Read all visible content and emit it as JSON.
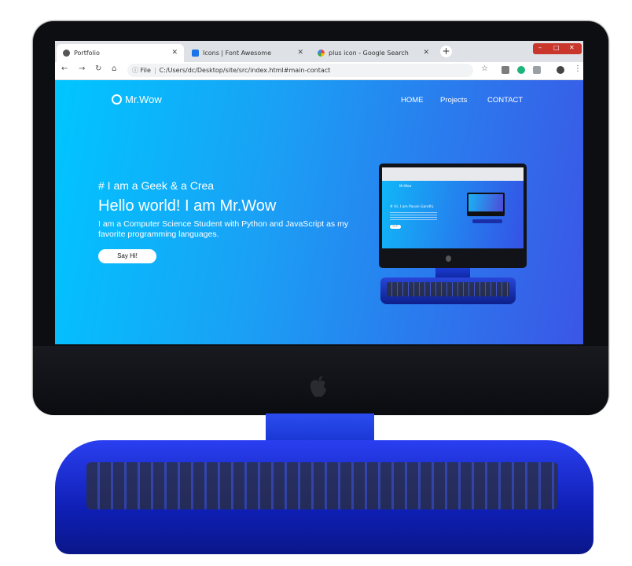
{
  "browser": {
    "tabs": [
      {
        "label": "Portfolio",
        "active": true,
        "icon": "globe-icon",
        "close": "✕"
      },
      {
        "label": "Icons | Font Awesome",
        "active": false,
        "icon": "font-awesome-icon",
        "close": "✕"
      },
      {
        "label": "plus icon - Google Search",
        "active": false,
        "icon": "google-icon",
        "close": "✕"
      }
    ],
    "new_tab": "+",
    "address": {
      "scheme_label": "File",
      "path": "C:/Users/dc/Desktop/site/src/index.html#main-contact"
    },
    "colors": {
      "tabstrip": "#dee1e6",
      "close_button": "#c9372c"
    }
  },
  "site": {
    "logo_text": "Mr.Wow",
    "nav": [
      "HOME",
      "Projects",
      "CONTACT"
    ],
    "tagline": "# I am a Geek & a Crea",
    "headline": "Hello world! I am Mr.Wow",
    "description": "I am a Computer Science Student with Python and JavaScript as my favorite programming languages.",
    "cta": "Say Hi!",
    "colors": {
      "gradient_start": "#00c6ff",
      "gradient_end": "#3b56e6"
    }
  },
  "mini_site": {
    "tagline": "# Hi, I am Pavan Gandhi.",
    "logo_text": "Mr.Wow",
    "cta": "Say Hi!"
  },
  "hardware": {
    "monitor_color": "#0d0e12",
    "stand_color": "#1f3de0",
    "logo_icon": "apple-icon"
  }
}
